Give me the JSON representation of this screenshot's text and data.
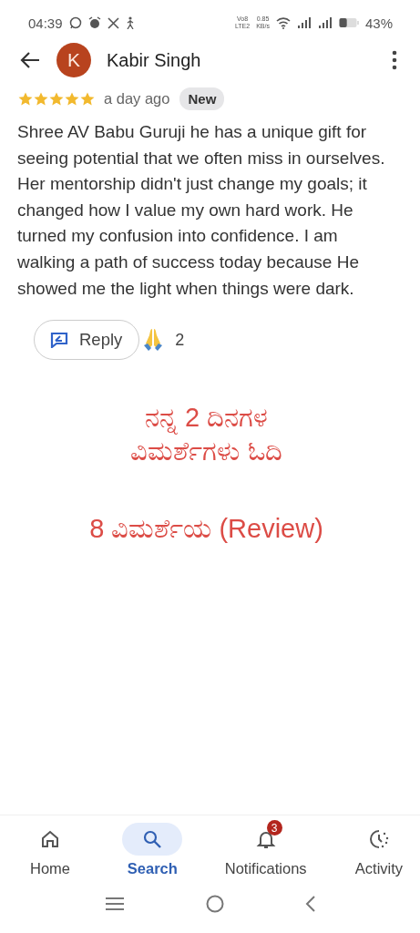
{
  "status_bar": {
    "time": "04:39",
    "volte": [
      "Vo8",
      "LTE2"
    ],
    "speed": [
      "0.85",
      "KB/s"
    ],
    "battery": "43%"
  },
  "header": {
    "avatar_letter": "K",
    "name": "Kabir Singh"
  },
  "review": {
    "stars": 5,
    "time": "a day ago",
    "badge": "New",
    "text": "Shree AV Babu Guruji he has a unique gift for seeing potential that we often miss in ourselves. Her mentorship didn't just change my goals; it changed how I value my own hard work. He turned my confusion into confidence. I am walking a path of success today because He showed me the light when things were dark."
  },
  "actions": {
    "reply": "Reply",
    "reaction_count": "2"
  },
  "caption_blocks": [
    {
      "lines": [
        "ನನ್ನ 2 ದಿನಗಳ",
        "ವಿಮರ್ಶೆಗಳು ಓದಿ"
      ]
    },
    {
      "lines": [
        "8 ವಿಮರ್ಶೆಯ (Review)"
      ]
    }
  ],
  "bottom_nav": [
    {
      "kind": "home",
      "label": "Home",
      "selected": false
    },
    {
      "kind": "search",
      "label": "Search",
      "selected": true
    },
    {
      "kind": "bell",
      "label": "Notifications",
      "selected": false,
      "badge": "3"
    },
    {
      "kind": "activity",
      "label": "Activity",
      "selected": false
    }
  ]
}
